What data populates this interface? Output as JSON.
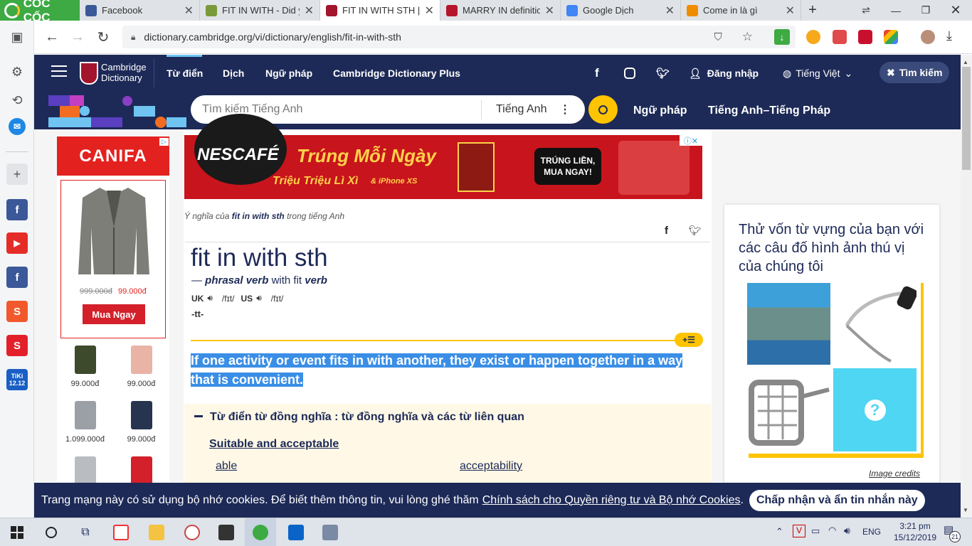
{
  "browser": {
    "brand": "CỐC CỐC",
    "tabs": [
      {
        "label": "Facebook",
        "icon": "facebook-icon",
        "color": "#3b5998"
      },
      {
        "label": "FIT IN WITH - Did you",
        "icon": "puzzle-icon",
        "color": "#7a9a3a"
      },
      {
        "label": "FIT IN WITH STH | Đị",
        "icon": "cambridge-icon",
        "color": "#a3152c",
        "active": true
      },
      {
        "label": "MARRY IN definition",
        "icon": "merriam-icon",
        "color": "#b5152b"
      },
      {
        "label": "Google Dịch",
        "icon": "google-translate-icon",
        "color": "#4285f4"
      },
      {
        "label": "Come in là gì",
        "icon": "j-icon",
        "color": "#f08c00"
      }
    ],
    "url": "dictionary.cambridge.org/vi/dictionary/english/fit-in-with-sth"
  },
  "header": {
    "logo_line1": "Cambridge",
    "logo_line2": "Dictionary",
    "nav": [
      "Từ điển",
      "Dịch",
      "Ngữ pháp",
      "Cambridge Dictionary Plus"
    ],
    "login": "Đăng nhập",
    "language": "Tiếng Việt",
    "search_toggle": "Tìm kiếm"
  },
  "searchbar": {
    "placeholder": "Tìm kiếm Tiếng Anh",
    "dictionary": "Tiếng Anh",
    "links": [
      "Ngữ pháp",
      "Tiếng Anh–Tiếng Pháp"
    ]
  },
  "left_ad": {
    "brand": "CANIFA",
    "old_price": "999.000đ",
    "new_price": "99.000đ",
    "cta": "Mua Ngay",
    "items": [
      {
        "price": "99.000đ",
        "color": "#3e4a2c"
      },
      {
        "price": "99.000đ",
        "color": "#e9b3a5"
      },
      {
        "price": "1.099.000đ",
        "color": "#9aa0a6"
      },
      {
        "price": "99.000đ",
        "color": "#26344f"
      },
      {
        "price": "",
        "color": "#b9bcc0"
      },
      {
        "price": "",
        "color": "#d3202a"
      }
    ]
  },
  "banner": {
    "brand": "NESCAFÉ",
    "headline": "Trúng Mỗi Ngày",
    "sub": "Triệu Triệu Lì Xì",
    "sub2": "& iPhone XS",
    "badge": "TRÚNG LIỀN, MUA NGAY!"
  },
  "entry": {
    "meaning_prefix": "Ý nghĩa của",
    "meaning_word": "fit in with sth",
    "meaning_suffix": "trong tiếng Anh",
    "headword": "fit in with sth",
    "pos_dash": "—",
    "pos": "phrasal verb",
    "with_label": "with",
    "with_word": "fit",
    "verb_label": "verb",
    "uk_label": "UK",
    "uk_ipa": "/fɪt/",
    "us_label": "US",
    "us_ipa": "/fɪt/",
    "inflection": "-tt-",
    "definition": "If one activity or event fits in with another, they exist or happen together in a way that is convenient.",
    "thesaurus_title": "Từ điển từ đồng nghĩa : từ đồng nghĩa và các từ liên quan",
    "thesaurus_group": "Suitable and acceptable",
    "related": [
      "able",
      "acceptability"
    ]
  },
  "quiz": {
    "title": "Thử vốn từ vựng của bạn với các câu đố hình ảnh thú vị của chúng tôi",
    "credits": "Image credits"
  },
  "cookie": {
    "text": "Trang mạng này có sử dụng bộ nhớ cookies. Để biết thêm thông tin, vui lòng ghé thăm",
    "link": "Chính sách cho Quyền riêng tư và Bộ nhớ Cookies",
    "end": ".",
    "button": "Chấp nhận và ẩn tin nhắn này"
  },
  "sidebar_badges": {
    "tiki": "TiKi",
    "tiki_date": "12.12"
  },
  "taskbar": {
    "lang": "ENG",
    "time": "3:21 pm",
    "date": "15/12/2019",
    "notif": "21"
  }
}
